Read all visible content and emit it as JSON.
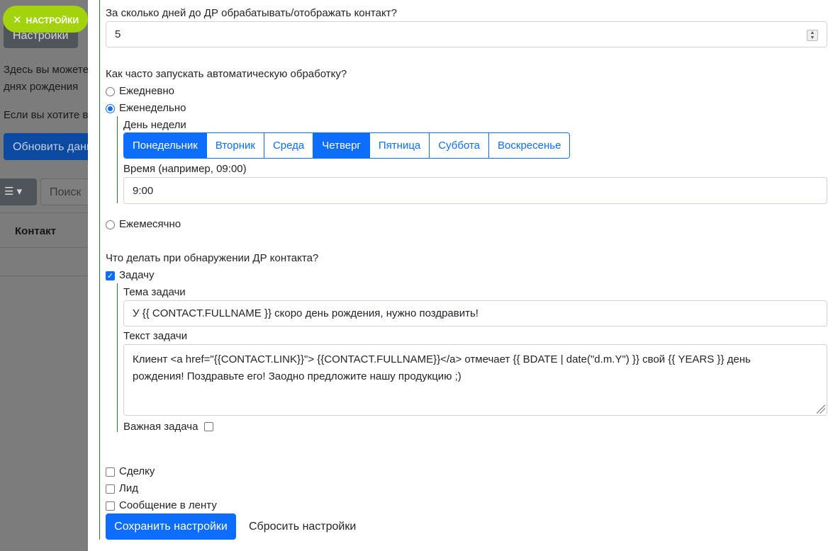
{
  "background": {
    "settings_button": "Настройки",
    "text_line1": "Здесь вы можете",
    "text_line2": "днях рождения",
    "text_line3": "Если вы хотите в",
    "update_button": "Обновить данн",
    "search_placeholder": "Поиск",
    "table_header_contact": "Контакт"
  },
  "badge": {
    "label": "НАСТРОЙКИ"
  },
  "form": {
    "days_label": "За сколько дней до ДР обрабатывать/отображать контакт?",
    "days_value": "5",
    "frequency_label": "Как часто запускать автоматическую обработку?",
    "freq_daily": "Ежедневно",
    "freq_weekly": "Еженедельно",
    "weekday_label": "День недели",
    "weekdays": [
      {
        "label": "Понедельник",
        "active": true
      },
      {
        "label": "Вторник",
        "active": false
      },
      {
        "label": "Среда",
        "active": false
      },
      {
        "label": "Четверг",
        "active": true
      },
      {
        "label": "Пятница",
        "active": false
      },
      {
        "label": "Суббота",
        "active": false
      },
      {
        "label": "Воскресенье",
        "active": false
      }
    ],
    "time_label": "Время (например, 09:00)",
    "time_value": "9:00",
    "freq_monthly": "Ежемесячно",
    "action_label": "Что делать при обнаружении ДР контакта?",
    "task_label": "Задачу",
    "task_subject_label": "Тема задачи",
    "task_subject_value": "У {{ CONTACT.FULLNAME }} скоро день рождения, нужно поздравить!",
    "task_text_label": "Текст задачи",
    "task_text_line1": "Клиент <a href=\"{{CONTACT.LINK}}\"> {{CONTACT.FULLNAME}}</a> отмечает {{ BDATE | date(\"d.m.Y\") }} свой {{ YEARS }} день",
    "task_text_line2": "рождения! Поздравьте его! Заодно предложите нашу продукцию ;)",
    "important_task_label": "Важная задача",
    "deal_label": "Сделку",
    "lead_label": "Лид",
    "feed_label": "Сообщение в ленту",
    "save_button": "Сохранить настройки",
    "reset_button": "Сбросить настройки"
  }
}
